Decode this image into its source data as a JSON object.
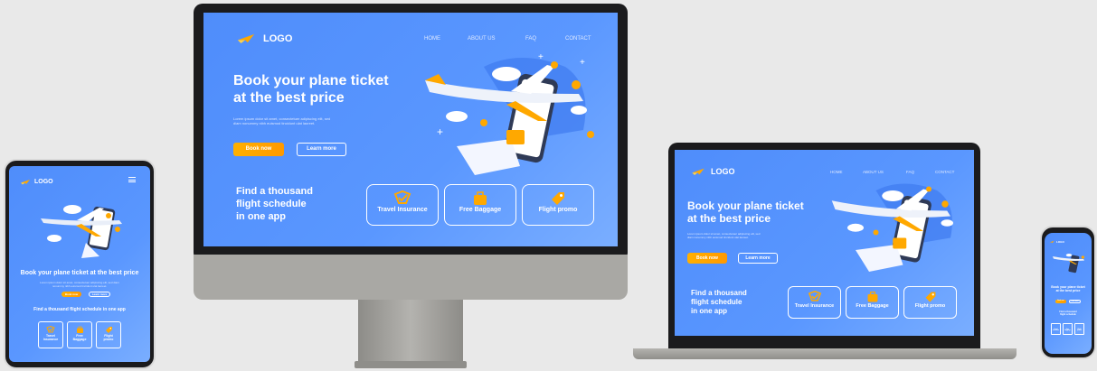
{
  "brand": {
    "logo": "LOGO"
  },
  "nav": {
    "home": "HOME",
    "about": "ABOUT US",
    "faq": "FAQ",
    "contact": "CONTACT"
  },
  "hero": {
    "title_line1": "Book your plane ticket",
    "title_line2": "at the best price",
    "title_single": "Book your plane ticket at the best price",
    "desc_line1": "Lorem ipsum dolor sit amet, consectetuer adipiscing elit, sed",
    "desc_line2": "diam nonummy nibh euismod tincidunt ulat laoreet.",
    "book_now": "Book now",
    "learn_more": "Learn more"
  },
  "tagline": {
    "line1": "Find a thousand",
    "line2": "flight schedule",
    "line3": "in one app",
    "single": "Find a thousand flight schedule in one app"
  },
  "features": [
    {
      "label": "Travel Insurance",
      "icon": "shield-check-icon"
    },
    {
      "label": "Free Baggage",
      "icon": "suitcase-icon"
    },
    {
      "label": "Flight promo",
      "icon": "tag-icon"
    }
  ],
  "features_tablet": [
    {
      "line1": "Travel",
      "line2": "Insurance"
    },
    {
      "line1": "Free",
      "line2": "Baggage"
    },
    {
      "line1": "Flight",
      "line2": "promo"
    }
  ],
  "colors": {
    "accent": "#ff9f00",
    "bg": "#5592fd"
  }
}
